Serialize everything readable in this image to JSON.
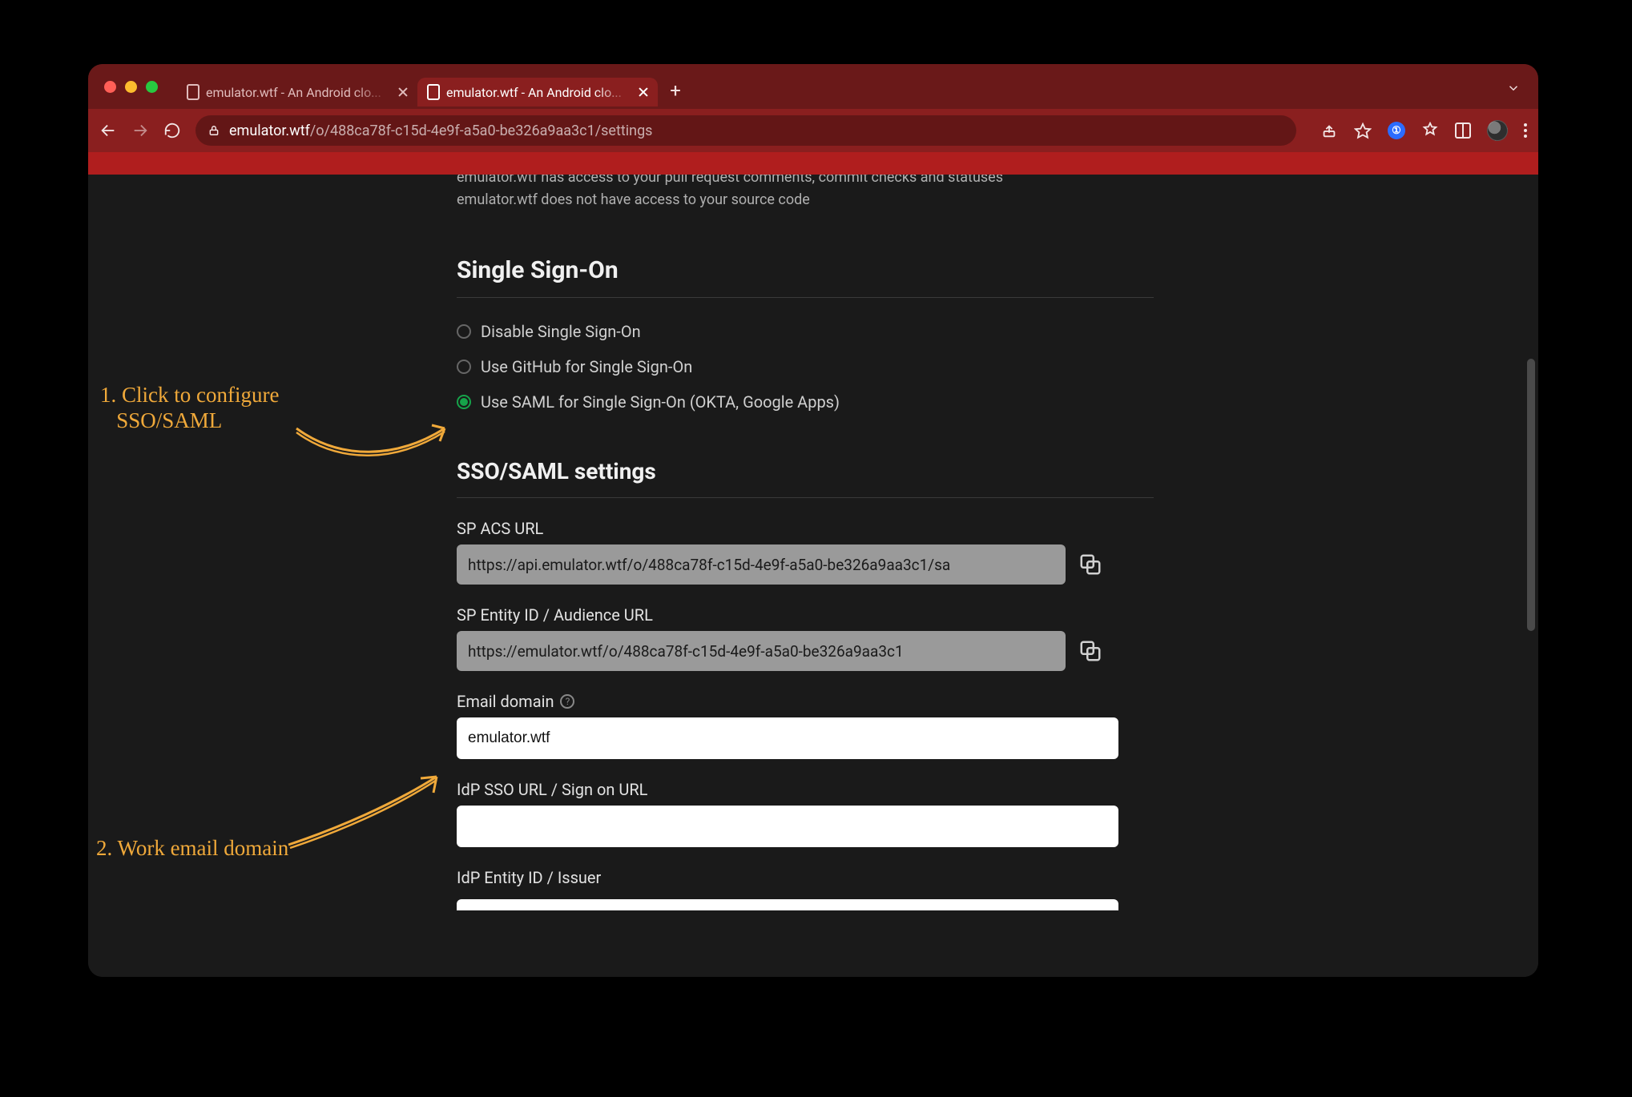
{
  "browser": {
    "tabs": [
      {
        "title": "emulator.wtf - An Android clo...",
        "active": false
      },
      {
        "title": "emulator.wtf - An Android clo...",
        "active": true
      }
    ],
    "url_host": "emulator.wtf",
    "url_path": "/o/488ca78f-c15d-4e9f-a5a0-be326a9aa3c1/settings"
  },
  "access_info": {
    "line1": "emulator.wtf has access to your pull request comments, commit checks and statuses",
    "line2": "emulator.wtf does not have access to your source code"
  },
  "sso": {
    "heading": "Single Sign-On",
    "options": {
      "disable": "Disable Single Sign-On",
      "github": "Use GitHub for Single Sign-On",
      "saml": "Use SAML for Single Sign-On (OKTA, Google Apps)"
    },
    "selected": "saml"
  },
  "saml": {
    "heading": "SSO/SAML settings",
    "sp_acs": {
      "label": "SP ACS URL",
      "value": "https://api.emulator.wtf/o/488ca78f-c15d-4e9f-a5a0-be326a9aa3c1/sa"
    },
    "sp_entity": {
      "label": "SP Entity ID / Audience URL",
      "value": "https://emulator.wtf/o/488ca78f-c15d-4e9f-a5a0-be326a9aa3c1"
    },
    "email_domain": {
      "label": "Email domain",
      "value": "emulator.wtf"
    },
    "idp_sso": {
      "label": "IdP SSO URL / Sign on URL",
      "value": ""
    },
    "idp_entity": {
      "label": "IdP Entity ID / Issuer",
      "value": ""
    }
  },
  "annotations": {
    "a1_line1": "1. Click to configure",
    "a1_line2": "SSO/SAML",
    "a2": "2. Work email domain"
  }
}
